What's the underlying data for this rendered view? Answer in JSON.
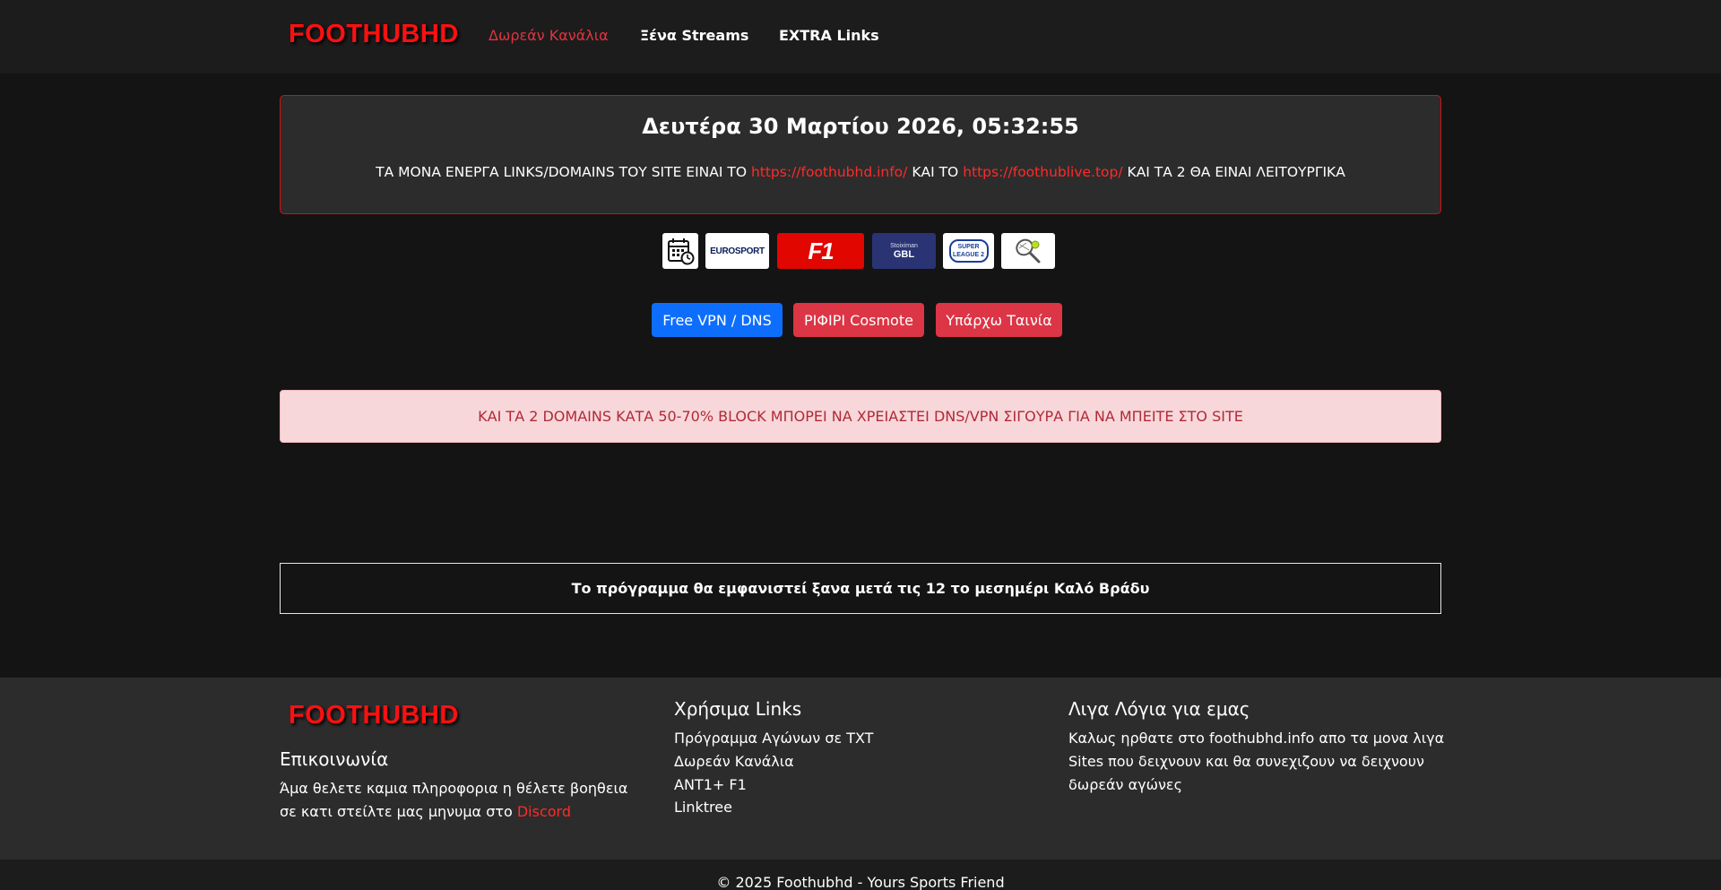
{
  "navbar": {
    "logo": "FOOTHUBHD",
    "links": [
      {
        "label": "Δωρεάν Κανάλια",
        "active": true
      },
      {
        "label": "Ξένα Streams",
        "active": false
      },
      {
        "label": "EXTRA Links",
        "active": false
      }
    ]
  },
  "info": {
    "datetime": "Δευτέρα 30 Μαρτίου 2026, 05:32:55",
    "text_before": "ΤΑ ΜΟΝΑ ΕΝΕΡΓΑ LINKS/DOMAINS ΤΟΥ SITE ΕΙΝΑΙ ΤΟ ",
    "link1": "https://foothubhd.info/",
    "text_middle": " ΚΑΙ ΤΟ ",
    "link2": "https://foothublive.top/",
    "text_after": " ΚΑΙ ΤΑ 2 ΘΑ ΕΙΝΑΙ ΛΕΙΤΟΥΡΓΙΚΑ"
  },
  "logo_strip": [
    {
      "name": "calendar-icon"
    },
    {
      "name": "eurosport-logo",
      "text": "EUROSPORT"
    },
    {
      "name": "f1-logo",
      "text": "F1"
    },
    {
      "name": "gbl-logo",
      "text": "GBL",
      "subtext": "Stoiximan"
    },
    {
      "name": "super-league-2-logo",
      "text": "SUPER LEAGUE 2"
    },
    {
      "name": "tennis-icon"
    }
  ],
  "buttons": [
    {
      "label": "Free VPN / DNS",
      "color": "#0d6efd"
    },
    {
      "label": "ΡΙΦΙΡΙ Cosmote",
      "color": "#dc3545"
    },
    {
      "label": "Υπάρχω Ταινία",
      "color": "#dc3545"
    }
  ],
  "alert": "ΚΑΙ ΤΑ 2 DOMAINS ΚΑΤΑ 50-70% BLOCK ΜΠΟΡΕΙ ΝΑ ΧΡΕΙΑΣΤΕΙ DNS/VPN ΣΙΓΟΥΡΑ ΓΙΑ ΝΑ ΜΠΕΙΤΕ ΣΤΟ SITE",
  "schedule_notice": "Το πρόγραμμα θα εμφανιστεί ξανα μετά τις 12 το μεσημέρι Καλό Βράδυ",
  "footer": {
    "logo": "FOOTHUBHD",
    "contact_title": "Επικοινωνία",
    "contact_text": "Άμα θελετε καμια πληροφορια η θέλετε βοηθεια σε κατι στείλτε μας μηνυμα στο ",
    "contact_link": "Discord",
    "links_title": "Χρήσιμα Links",
    "links": [
      "Πρόγραμμα Αγώνων σε TXT",
      "Δωρεάν Κανάλια",
      "ANT1+ F1",
      "Linktree"
    ],
    "about_title": "Λιγα Λόγια για εμας",
    "about_text": "Καλως ηρθατε στο foothubhd.info απο τα μονα λιγα Sites που δειχνουν και θα συνεχιζουν να δειχνουν δωρεάν αγώνες"
  },
  "copyright": "© 2025 Foothubhd - Yours Sports Friend",
  "colors": {
    "brand_red": "#ff1010",
    "primary_blue": "#0d6efd",
    "danger_red": "#dc3545",
    "alert_bg": "#f8d7da",
    "alert_text": "#b02a37"
  }
}
